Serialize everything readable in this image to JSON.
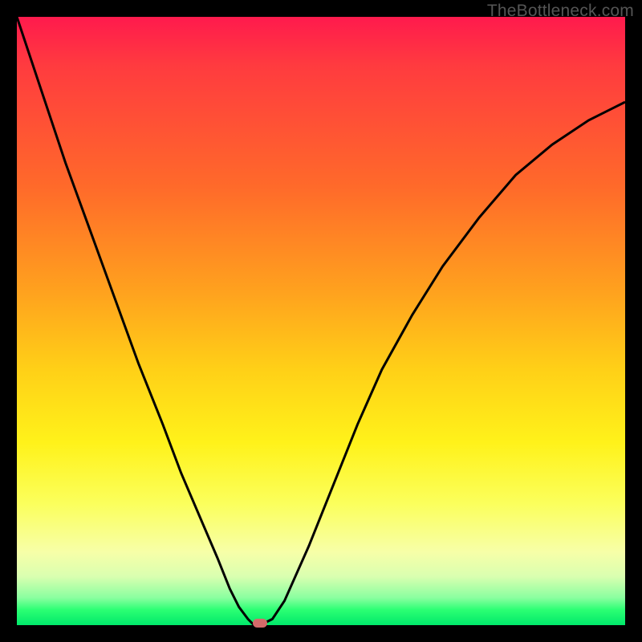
{
  "watermark_text": "TheBottleneck.com",
  "colors": {
    "frame_bg": "#000000",
    "curve_stroke": "#000000",
    "marker_fill": "#d46a6a",
    "gradient_top": "#ff1a4d",
    "gradient_bottom": "#00e86a"
  },
  "chart_data": {
    "type": "line",
    "title": "",
    "xlabel": "",
    "ylabel": "",
    "xlim": [
      0,
      100
    ],
    "ylim": [
      0,
      100
    ],
    "grid": false,
    "x": [
      0,
      4,
      8,
      12,
      16,
      20,
      24,
      27,
      30,
      33,
      35,
      36.5,
      38,
      39,
      40,
      42,
      44,
      48,
      52,
      56,
      60,
      65,
      70,
      76,
      82,
      88,
      94,
      100
    ],
    "values": [
      100,
      88,
      76,
      65,
      54,
      43,
      33,
      25,
      18,
      11,
      6,
      3,
      1,
      0,
      0,
      1,
      4,
      13,
      23,
      33,
      42,
      51,
      59,
      67,
      74,
      79,
      83,
      86
    ],
    "marker": {
      "x": 40,
      "y": 0
    },
    "note": "Values approximate the V-shaped curve where 0 = bottom (green, optimal) and 100 = top (red, worst). Minimum at x≈39–40."
  }
}
